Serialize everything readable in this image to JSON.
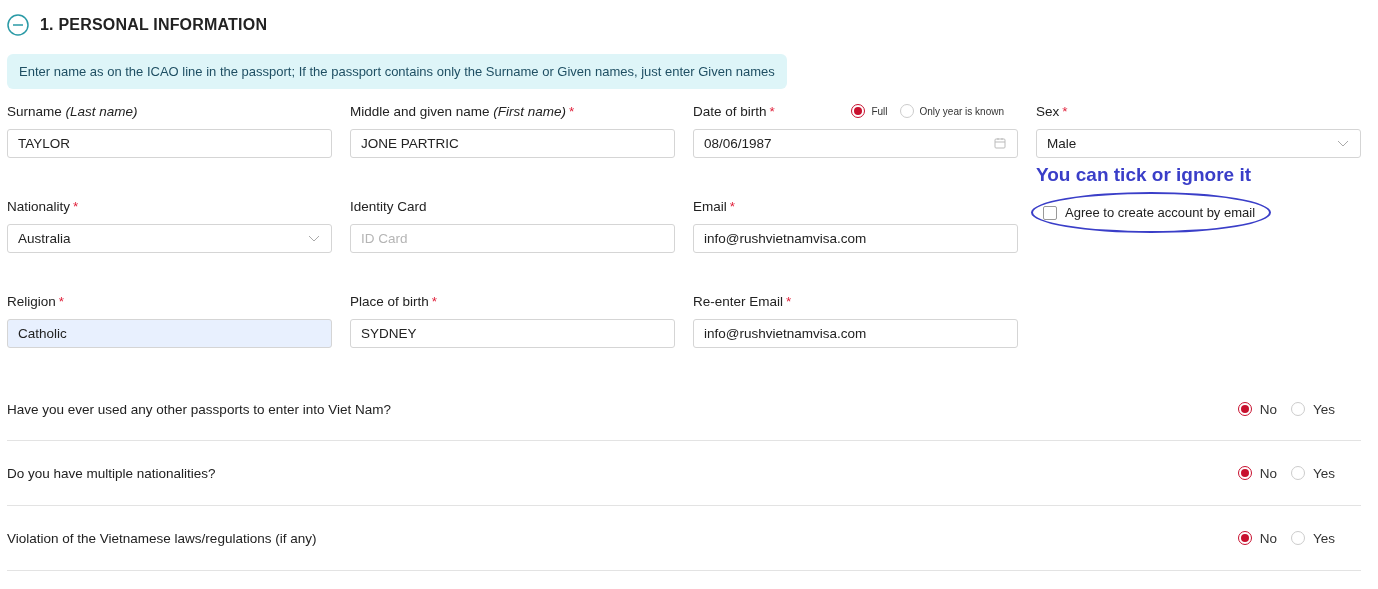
{
  "section": {
    "title": "1. PERSONAL INFORMATION",
    "expanded": true
  },
  "notice": "Enter name as on the ICAO line in the passport; If the passport contains only the Surname or Given names, just enter Given names",
  "fields": [
    {
      "kind": "text",
      "label": "Surname *(Last name)*",
      "value": "TAYLOR"
    },
    {
      "kind": "text",
      "label": "Middle and given name *(First name)*",
      "required_mark": "*",
      "value": "JONE PARTRIC"
    },
    {
      "kind": "date",
      "label": "Date of birth",
      "required_mark": "*",
      "value": "08/06/1987",
      "options": [
        {
          "label": "Full",
          "selected": true
        },
        {
          "label": "Only year is known",
          "selected": false
        }
      ]
    },
    {
      "kind": "select",
      "label": "Sex",
      "required_mark": "*",
      "value": "Male"
    },
    {
      "kind": "select",
      "label": "Nationality",
      "required_mark": "*",
      "value": "Australia"
    },
    {
      "kind": "text",
      "label": "Identity Card",
      "placeholder": "ID Card"
    },
    {
      "kind": "text",
      "label": "Email",
      "required_mark": "*",
      "value": "info@rushvietnamvisa.com"
    },
    {
      "kind": "consent",
      "annotation": "You can tick or ignore it",
      "label": "Agree to create account by email",
      "checked": false
    },
    {
      "kind": "text",
      "label": "Religion",
      "required_mark": "*",
      "value": "Catholic",
      "autofilled": true
    },
    {
      "kind": "text",
      "label": "Place of birth",
      "required_mark": "*",
      "value": "SYDNEY"
    },
    {
      "kind": "text",
      "label": "Re-enter Email",
      "required_mark": "*",
      "value": "info@rushvietnamvisa.com"
    }
  ],
  "questions": [
    {
      "text": "Have you ever used any other passports to enter into Viet Nam?",
      "options": [
        {
          "label": "No",
          "selected": true
        },
        {
          "label": "Yes",
          "selected": false
        }
      ]
    },
    {
      "text": "Do you have multiple nationalities?",
      "options": [
        {
          "label": "No",
          "selected": true
        },
        {
          "label": "Yes",
          "selected": false
        }
      ]
    },
    {
      "text": "Violation of the Vietnamese laws/regulations (if any)",
      "options": [
        {
          "label": "No",
          "selected": true
        },
        {
          "label": "Yes",
          "selected": false
        }
      ]
    }
  ]
}
